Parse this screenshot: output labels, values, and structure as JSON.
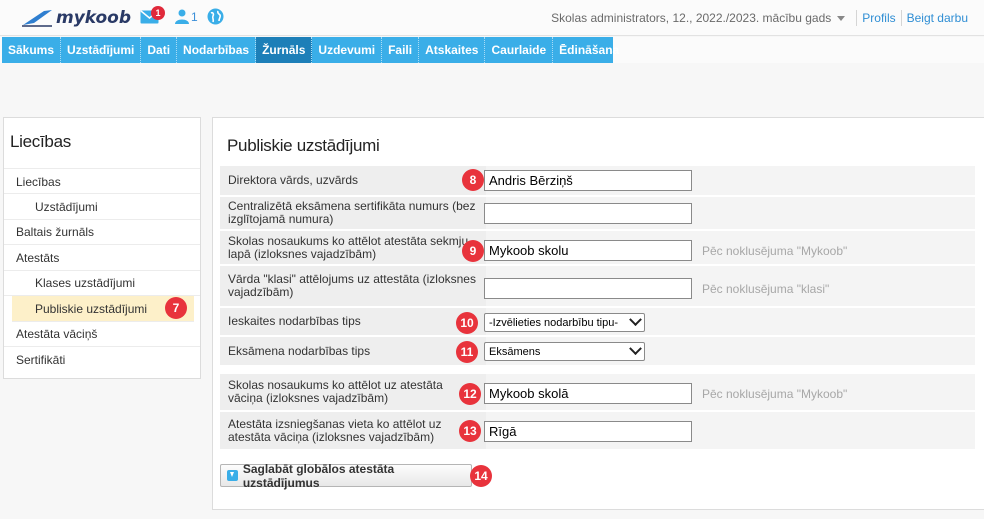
{
  "header": {
    "logo_text": "mykoob",
    "mail_badge": "1",
    "user_count": "1",
    "session": "Skolas administrators, 12., 2022./2023. mācību gads",
    "profile_link": "Profils",
    "logout_link": "Beigt darbu",
    "accent": "#3aaee8"
  },
  "nav": {
    "items": [
      "Sākums",
      "Uzstādījumi",
      "Dati",
      "Nodarbības",
      "Žurnāls",
      "Uzdevumi",
      "Faili",
      "Atskaites",
      "Caurlaide",
      "Ēdināšana"
    ],
    "active": "Žurnāls"
  },
  "sidebar": {
    "title": "Liecības",
    "items": [
      {
        "label": "Liecības"
      },
      {
        "label": "Uzstādījumi"
      },
      {
        "label": "Baltais žurnāls"
      },
      {
        "label": "Atestāts"
      },
      {
        "label": "Klases uzstādījumi"
      },
      {
        "label": "Publiskie uzstādījumi",
        "badge": "7"
      },
      {
        "label": "Atestāta vāciņš"
      },
      {
        "label": "Sertifikāti"
      }
    ]
  },
  "main": {
    "title": "Publiskie uzstādījumi",
    "rows": [
      {
        "label": "Direktora vārds, uzvārds",
        "value": "Andris Bērziņš",
        "badge": "8"
      },
      {
        "label": "Centralizētā eksāmena sertifikāta numurs (bez izglītojamā numura)",
        "value": ""
      },
      {
        "label": "Skolas nosaukums ko attēlot atestāta sekmju lapā (izloksnes vajadzībām)",
        "value": "Mykoob skolu",
        "hint": "Pēc noklusējuma \"Mykoob\"",
        "badge": "9"
      },
      {
        "label": "Vārda \"klasi\" attēlojums uz attestāta (izloksnes vajadzībām)",
        "value": "",
        "hint": "Pēc noklusējuma \"klasi\""
      },
      {
        "label": "Ieskaites nodarbības tips",
        "value": "-Izvēlieties nodarbību tipu-",
        "badge": "10"
      },
      {
        "label": "Eksāmena nodarbības tips",
        "value": "Eksāmens",
        "badge": "11"
      },
      {
        "label": "Skolas nosaukums ko attēlot uz atestāta vāciņa (izloksnes vajadzībām)",
        "value": "Mykoob skolā",
        "hint": "Pēc noklusējuma \"Mykoob\"",
        "badge": "12"
      },
      {
        "label": "Atestāta izsniegšanas vieta ko attēlot uz atestāta vāciņa (izloksnes vajadzībām)",
        "value": "Rīgā",
        "badge": "13"
      }
    ],
    "save_label": "Saglabāt globālos atestāta uzstādījumus",
    "save_badge": "14"
  }
}
